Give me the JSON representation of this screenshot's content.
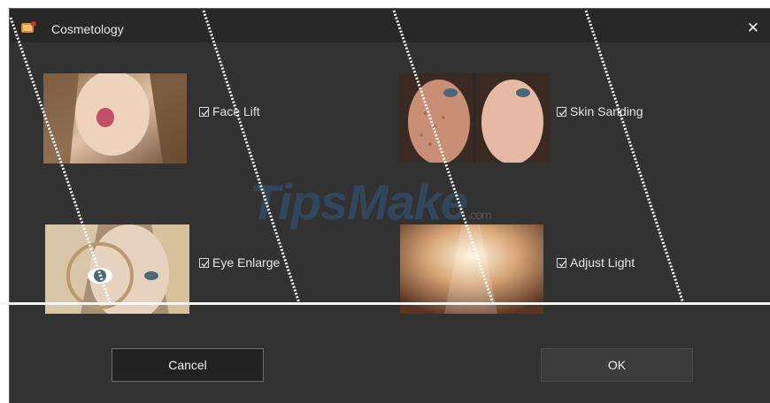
{
  "window": {
    "title": "Cosmetology",
    "close_glyph": "✕"
  },
  "options": {
    "face_lift": {
      "label": "Face Lift",
      "checked": true
    },
    "skin_sanding": {
      "label": "Skin Sanding",
      "checked": true
    },
    "eye_enlarge": {
      "label": "Eye Enlarge",
      "checked": true
    },
    "adjust_light": {
      "label": "Adjust Light",
      "checked": true
    }
  },
  "buttons": {
    "cancel": "Cancel",
    "ok": "OK"
  },
  "watermark": {
    "brand": "TipsMake",
    "suffix": ".com"
  },
  "colors": {
    "dialog_bg": "#323232",
    "titlebar_bg": "#282828",
    "text": "#e6e6e6"
  }
}
